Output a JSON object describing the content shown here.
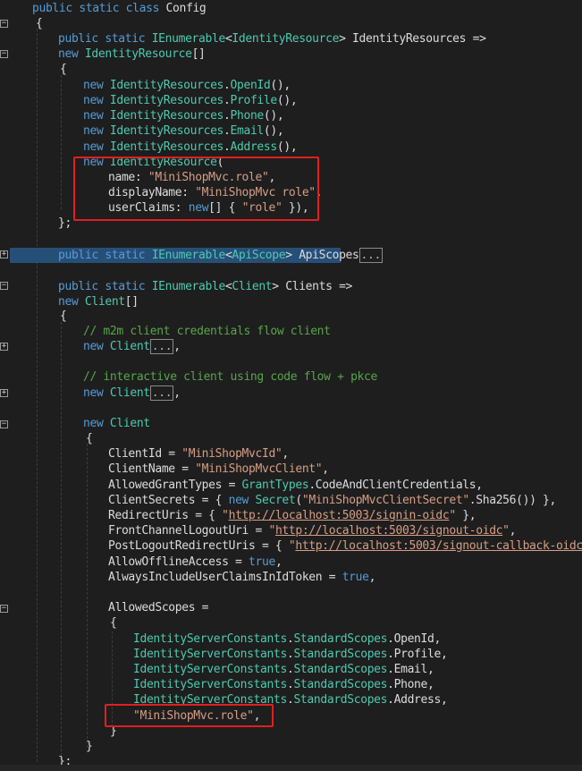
{
  "colors": {
    "background": "#1e1e1e",
    "keyword": "#569cd6",
    "type": "#4ec9b0",
    "string": "#d69d85",
    "comment": "#57a64a",
    "text": "#dcdcdc",
    "selection": "#264f78",
    "highlight_box": "#e02020"
  },
  "code": {
    "l01": {
      "kw1": "public static class",
      "rest": " Config"
    },
    "l02": {
      "p": "{"
    },
    "l03": {
      "kw1": "public static",
      "ty1": "IEnumerable",
      "p1": "<",
      "ty2": "IdentityResource",
      "p2": "> IdentityResources =>"
    },
    "l04": {
      "kw1": "new",
      "ty1": "IdentityResource",
      "p1": "[]"
    },
    "l05": {
      "p": "{"
    },
    "l06": {
      "kw1": "new",
      "ty1": "IdentityResources",
      "p1": ".",
      "ty2": "OpenId",
      "p2": "(),"
    },
    "l07": {
      "kw1": "new",
      "ty1": "IdentityResources",
      "p1": ".",
      "ty2": "Profile",
      "p2": "(),"
    },
    "l08": {
      "kw1": "new",
      "ty1": "IdentityResources",
      "p1": ".",
      "ty2": "Phone",
      "p2": "(),"
    },
    "l09": {
      "kw1": "new",
      "ty1": "IdentityResources",
      "p1": ".",
      "ty2": "Email",
      "p2": "(),"
    },
    "l10": {
      "kw1": "new",
      "ty1": "IdentityResources",
      "p1": ".",
      "ty2": "Address",
      "p2": "(),"
    },
    "l11": {
      "kw1": "new",
      "ty1": "IdentityResource",
      "p1": "("
    },
    "l12": {
      "p1": "name: ",
      "st1": "\"MiniShopMvc.role\"",
      "p2": ","
    },
    "l13": {
      "p1": "displayName: ",
      "st1": "\"MiniShopMvc role\"",
      "p2": ","
    },
    "l14": {
      "p1": "userClaims: ",
      "kw1": "new",
      "p2": "[] { ",
      "st1": "\"role\"",
      "p3": " }),"
    },
    "l15": {
      "p": "};"
    },
    "l16": {
      "kw1": "public static",
      "ty1": "IEnumerable",
      "p1": "<",
      "ty2": "ApiScope",
      "p2": "> ApiScopes",
      "collapsed": "..."
    },
    "l17": {
      "kw1": "public static",
      "ty1": "IEnumerable",
      "p1": "<",
      "ty2": "Client",
      "p2": "> Clients =>"
    },
    "l18": {
      "kw1": "new",
      "ty1": "Client",
      "p1": "[]"
    },
    "l19": {
      "p": "{"
    },
    "l20": {
      "cm": "// m2m client credentials flow client"
    },
    "l21": {
      "kw1": "new",
      "ty1": "Client",
      "collapsed": "...",
      "p1": ","
    },
    "l22": {
      "cm": "// interactive client using code flow + pkce"
    },
    "l23": {
      "kw1": "new",
      "ty1": "Client",
      "collapsed": "...",
      "p1": ","
    },
    "l24": {
      "kw1": "new",
      "ty1": "Client"
    },
    "l25": {
      "p": "{"
    },
    "l26": {
      "p1": "ClientId = ",
      "st1": "\"MiniShopMvcId\"",
      "p2": ","
    },
    "l27": {
      "p1": "ClientName = ",
      "st1": "\"MiniShopMvcClient\"",
      "p2": ","
    },
    "l28": {
      "p1": "AllowedGrantTypes = ",
      "ty1": "GrantTypes",
      "p2": ".CodeAndClientCredentials,"
    },
    "l29": {
      "p1": "ClientSecrets = { ",
      "kw1": "new",
      "ty1": "Secret",
      "p2": "(",
      "st1": "\"MiniShopMvcClientSecret\"",
      "p3": ".Sha256()) },"
    },
    "l30": {
      "p1": "RedirectUris = { ",
      "st1": "\"",
      "url": "http://localhost:5003/signin-oidc",
      "st2": "\"",
      "p2": " },"
    },
    "l31": {
      "p1": "FrontChannelLogoutUri = ",
      "st1": "\"",
      "url": "http://localhost:5003/signout-oidc",
      "st2": "\"",
      "p2": ","
    },
    "l32": {
      "p1": "PostLogoutRedirectUris = { ",
      "st1": "\"",
      "url": "http://localhost:5003/signout-callback-oidc",
      "st2": "\"",
      "p2": " },"
    },
    "l33": {
      "p1": "AllowOfflineAccess = ",
      "kw1": "true",
      "p2": ","
    },
    "l34": {
      "p1": "AlwaysIncludeUserClaimsInIdToken = ",
      "kw1": "true",
      "p2": ","
    },
    "l35": {
      "p": "AllowedScopes ="
    },
    "l36": {
      "p": "{"
    },
    "l37": {
      "ty1": "IdentityServerConstants",
      "p1": ".",
      "ty2": "StandardScopes",
      "p2": ".OpenId,"
    },
    "l38": {
      "ty1": "IdentityServerConstants",
      "p1": ".",
      "ty2": "StandardScopes",
      "p2": ".Profile,"
    },
    "l39": {
      "ty1": "IdentityServerConstants",
      "p1": ".",
      "ty2": "StandardScopes",
      "p2": ".Email,"
    },
    "l40": {
      "ty1": "IdentityServerConstants",
      "p1": ".",
      "ty2": "StandardScopes",
      "p2": ".Phone,"
    },
    "l41": {
      "ty1": "IdentityServerConstants",
      "p1": ".",
      "ty2": "StandardScopes",
      "p2": ".Address,"
    },
    "l42": {
      "st1": "\"MiniShopMvc.role\"",
      "p1": ","
    },
    "l43": {
      "p": "}"
    },
    "l44": {
      "p": "}"
    },
    "l45": {
      "p": "};"
    }
  }
}
